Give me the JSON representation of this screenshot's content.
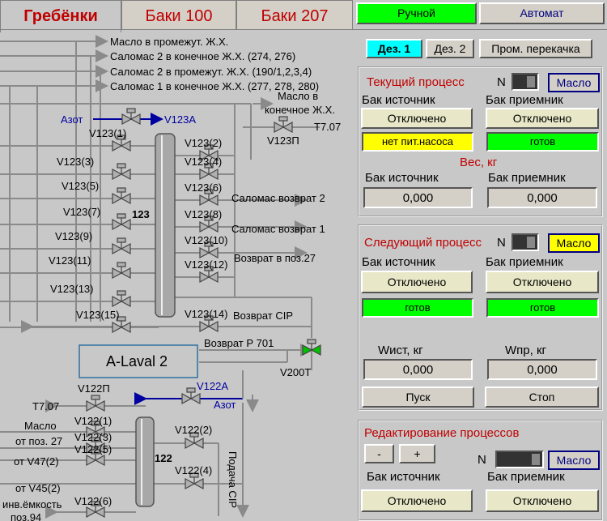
{
  "tabs": [
    "Гребёнки",
    "Баки 100",
    "Баки 207"
  ],
  "mode": {
    "manual": "Ручной",
    "auto": "Автомат"
  },
  "subtabs": [
    "Дез. 1",
    "Дез. 2",
    "Пром. перекачка"
  ],
  "diagram": {
    "top_lines": [
      "Масло в промежут. Ж.Х.",
      "Саломас 2 в конечное Ж.Х. (274, 276)",
      "Саломас 2 в промежут. Ж.Х. (190/1,2,3,4)",
      "Саломас 1 в конечное Ж.Х. (277, 278, 280)"
    ],
    "oil_final_1": "Масло в",
    "oil_final_2": "конечное Ж.Х.",
    "nitrogen": "Азот",
    "v123a": "V123A",
    "t707_top": "T7.07",
    "v123p": "V123П",
    "left_valves": [
      "V123(1)",
      "V123(3)",
      "V123(5)",
      "V123(7)",
      "V123(9)",
      "V123(11)",
      "V123(13)",
      "V123(15)"
    ],
    "right_valves": [
      "V123(2)",
      "V123(4)",
      "V123(6)",
      "V123(8)",
      "V123(10)",
      "V123(12)",
      "V123(14)"
    ],
    "column_123": "123",
    "return_lines": [
      "Саломас возврат 2",
      "Саломас возврат 1",
      "Возврат в поз.27",
      "Возврат CIP"
    ],
    "alaval": "A-Laval 2",
    "return_p701": "Возврат Р 701",
    "v200t": "V200T",
    "v122p": "V122П",
    "v122a": "V122A",
    "nitrogen2": "Азот",
    "t707_bottom": "T7.07",
    "v122_left": [
      "V122(1)",
      "V122(3)",
      "V122(5)",
      "V122(6)"
    ],
    "v122_right": [
      "V122(2)",
      "V122(4)"
    ],
    "column_122": "122",
    "oil_from_1": "Масло",
    "oil_from_2": "от поз. 27",
    "from_v47": "от V47(2)",
    "from_v45": "от V45(2)",
    "inv_1": "инв.ёмкость",
    "inv_2": "поз.94",
    "cip_supply": "Подача CIP"
  },
  "current": {
    "title": "Текущий процесс",
    "n_label": "N",
    "product": "Масло",
    "src_label": "Бак источник",
    "dst_label": "Бак приемник",
    "src_value": "Отключено",
    "dst_value": "Отключено",
    "src_status": "нет пит.насоса",
    "dst_status": "готов",
    "weight_title": "Вес, кг",
    "w_src_label": "Бак источник",
    "w_dst_label": "Бак приемник",
    "w_src": "0,000",
    "w_dst": "0,000"
  },
  "next": {
    "title": "Следующий процесс",
    "n_label": "N",
    "product": "Масло",
    "src_label": "Бак источник",
    "dst_label": "Бак приемник",
    "src_value": "Отключено",
    "dst_value": "Отключено",
    "src_status": "готов",
    "dst_status": "готов",
    "w_src_label": "Wист, кг",
    "w_dst_label": "Wпр, кг",
    "w_src": "0,000",
    "w_dst": "0,000",
    "start": "Пуск",
    "stop": "Стоп"
  },
  "edit": {
    "title": "Редактирование процессов",
    "minus": "-",
    "plus": "+",
    "n_label": "N",
    "product": "Масло",
    "src_label": "Бак источник",
    "dst_label": "Бак приемник",
    "src_value": "Отключено",
    "dst_value": "Отключено"
  },
  "colors": {
    "red_title": "#c00000",
    "green": "#00ff00",
    "yellow": "#ffff00",
    "cyan": "#00ffff",
    "blue_nitrogen": "#0000a0"
  }
}
